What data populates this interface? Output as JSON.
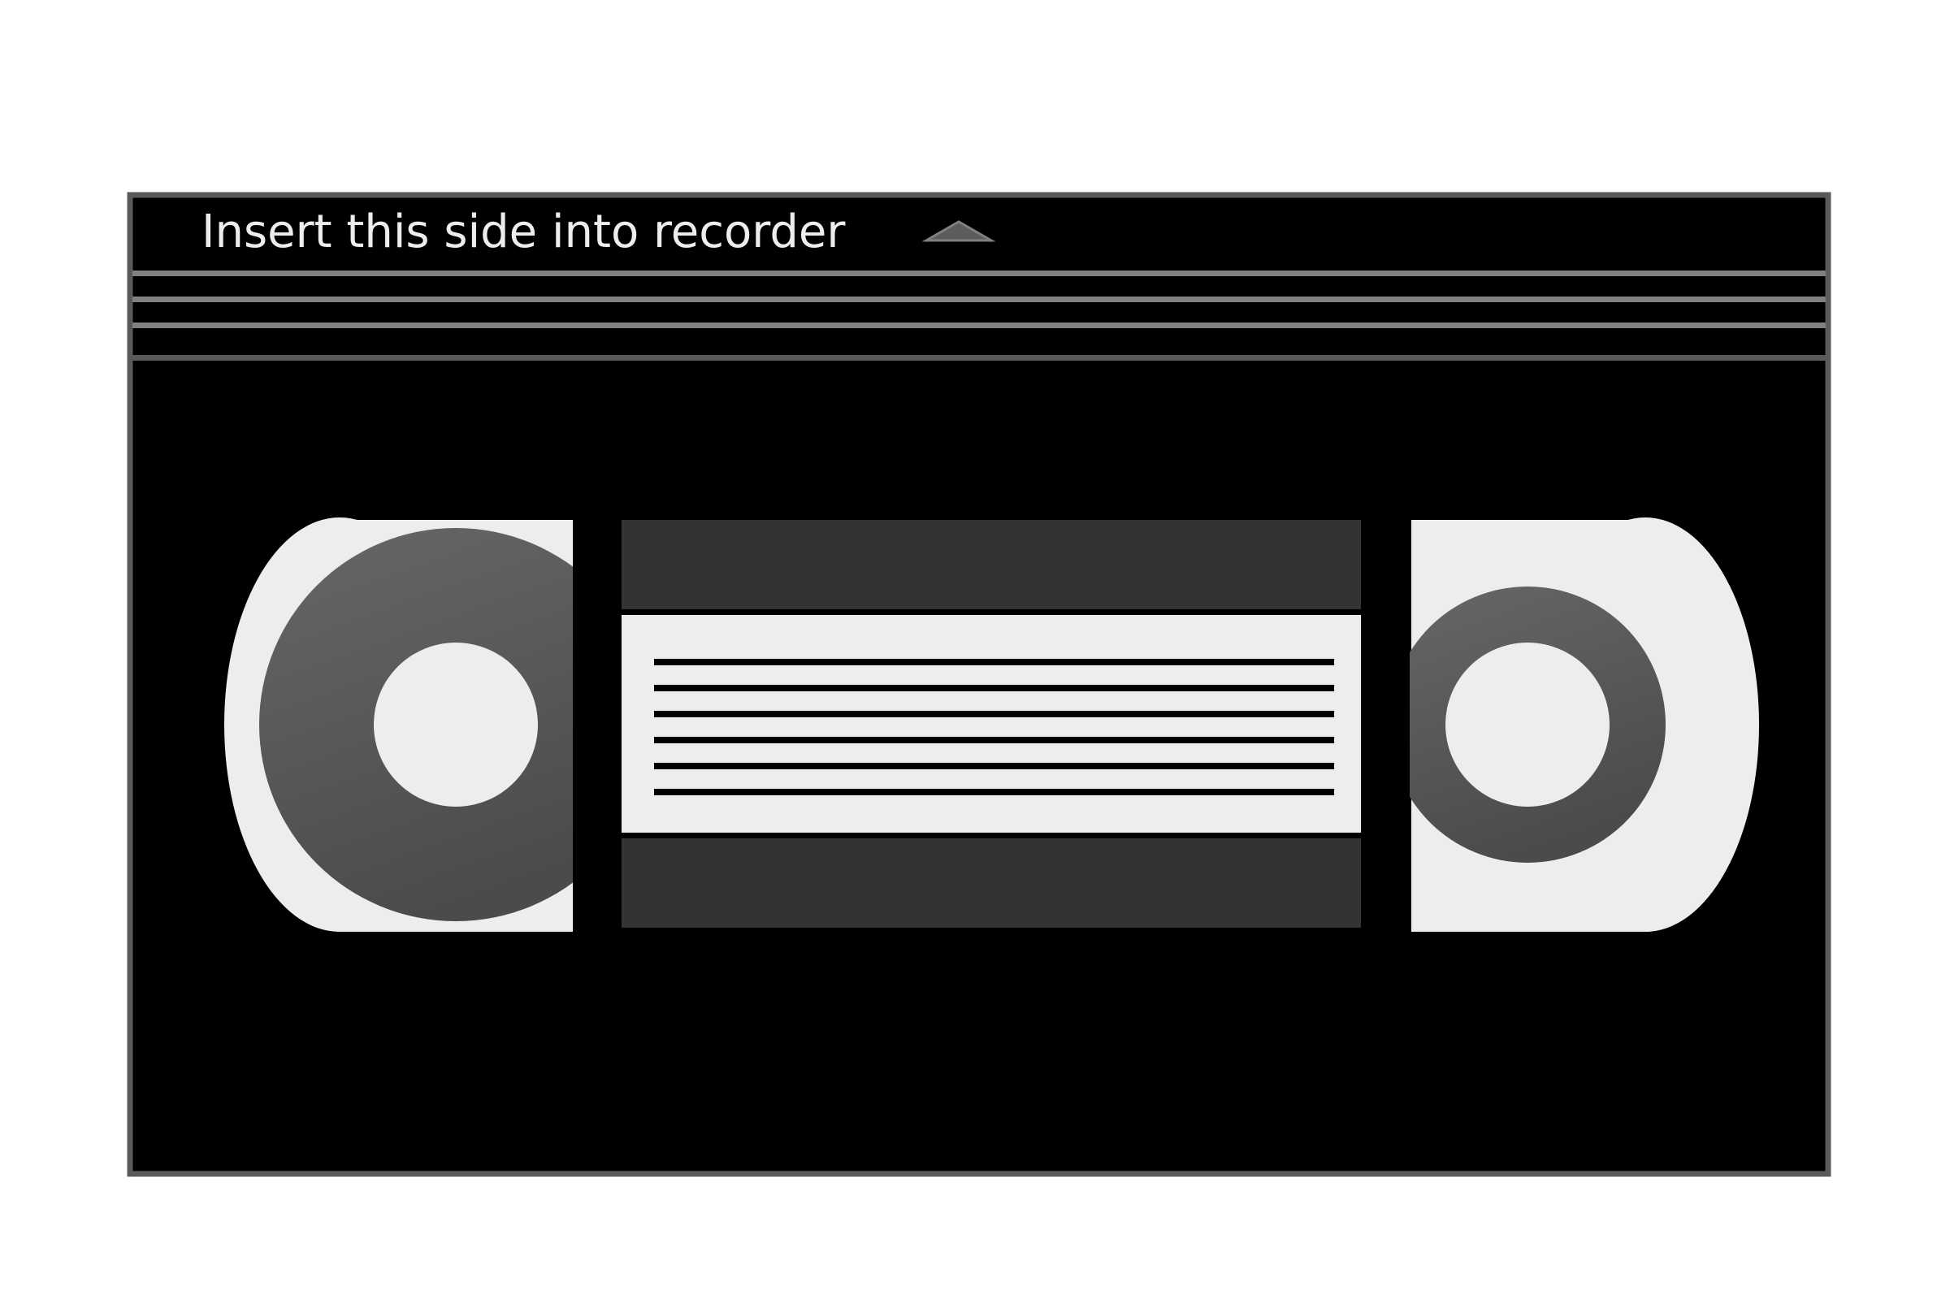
{
  "cassette": {
    "insert_label": "Insert this side into recorder",
    "icons": {
      "direction": "triangle-up-icon"
    },
    "colors": {
      "background": "#ffffff",
      "shell": "#000000",
      "shell_outline": "#5a5a5a",
      "ridge": "#808080",
      "label_panel": "#ededed",
      "window_tint": "#333333",
      "reel_hub": "#5c5c5c",
      "text": "#ededed"
    }
  }
}
